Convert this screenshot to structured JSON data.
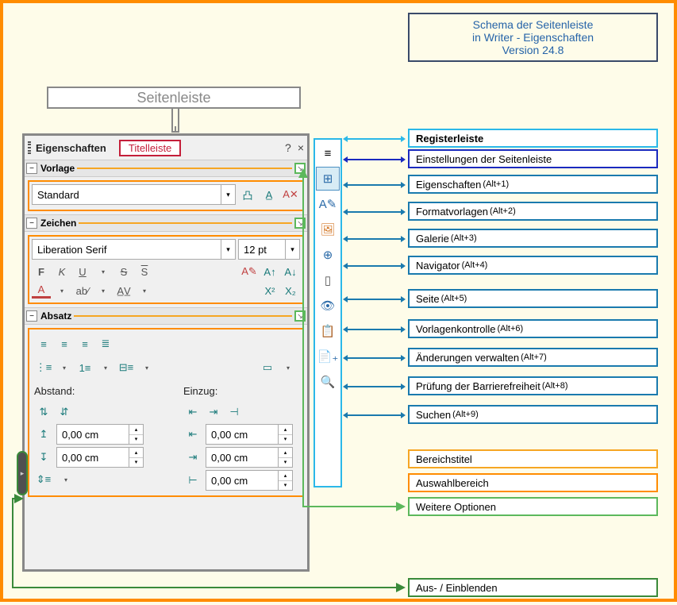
{
  "header": {
    "line1": "Schema der Seitenleiste",
    "line2": "in Writer - Eigenschaften",
    "line3": "Version 24.8"
  },
  "sidebar_label": "Seitenleiste",
  "titlebar": {
    "title": "Eigenschaften",
    "badge": "Titelleiste",
    "help": "?",
    "close": "×"
  },
  "sections": {
    "vorlage": {
      "title": "Vorlage",
      "style_value": "Standard"
    },
    "zeichen": {
      "title": "Zeichen",
      "font_value": "Liberation Serif",
      "size_value": "12 pt"
    },
    "absatz": {
      "title": "Absatz",
      "spacing_label": "Abstand:",
      "indent_label": "Einzug:",
      "v1": "0,00 cm",
      "v2": "0,00 cm",
      "v3": "0,00 cm",
      "v4": "0,00 cm",
      "v5": "0,00 cm"
    }
  },
  "legends": {
    "register": "Registerleiste",
    "settings": "Einstellungen der Seitenleiste",
    "l1": {
      "t": "Eigenschaften",
      "s": "(Alt+1)"
    },
    "l2": {
      "t": "Formatvorlagen",
      "s": "(Alt+2)"
    },
    "l3": {
      "t": "Galerie",
      "s": "(Alt+3)"
    },
    "l4": {
      "t": "Navigator",
      "s": "(Alt+4)"
    },
    "l5": {
      "t": "Seite",
      "s": "(Alt+5)"
    },
    "l6": {
      "t": "Vorlagenkontrolle",
      "s": "(Alt+6)"
    },
    "l7": {
      "t": "Änderungen verwalten",
      "s": "(Alt+7)"
    },
    "l8": {
      "t": "Prüfung der Barrierefreiheit",
      "s": "(Alt+8)"
    },
    "l9": {
      "t": "Suchen",
      "s": "(Alt+9)"
    },
    "area_title": "Bereichstitel",
    "area_select": "Auswahlbereich",
    "more_opt": "Weitere Optionen",
    "toggle": "Aus- / Einblenden"
  }
}
